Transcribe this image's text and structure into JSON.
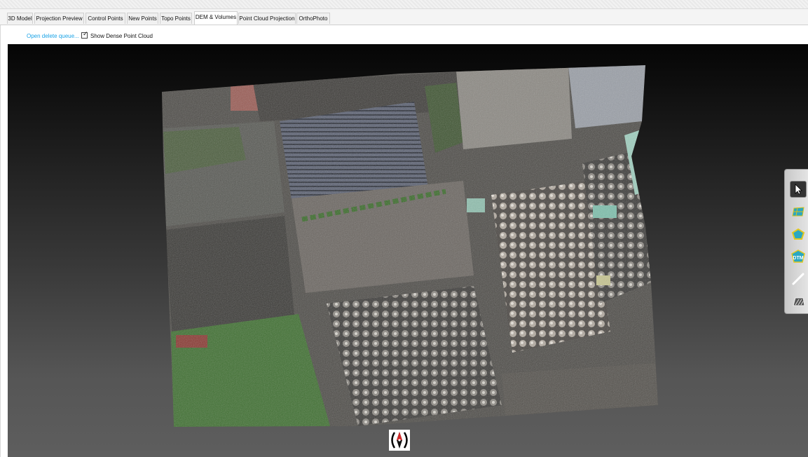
{
  "tabs": [
    {
      "label": "3D Model"
    },
    {
      "label": "Projection Preview"
    },
    {
      "label": "Control Points"
    },
    {
      "label": "New Points"
    },
    {
      "label": "Topo Points"
    },
    {
      "label": "DEM & Volumes",
      "active": true
    },
    {
      "label": "Point Cloud Projection"
    },
    {
      "label": "OrthoPhoto"
    }
  ],
  "toolbar": {
    "delete_queue_link": "Open delete queue...",
    "dense_cloud_label": "Show Dense Point Cloud",
    "dense_cloud_checked": true,
    "link_color": "#1aa3e6"
  },
  "viewport": {
    "tools": [
      {
        "icon": "cursor-select-icon",
        "selected": true
      },
      {
        "icon": "surface-mesh-icon"
      },
      {
        "icon": "polygon-icon"
      },
      {
        "icon": "dtm-icon",
        "label": "DTM"
      },
      {
        "icon": "measure-line-icon"
      },
      {
        "icon": "volume-icon"
      }
    ],
    "compass_icon": "compass-icon"
  }
}
